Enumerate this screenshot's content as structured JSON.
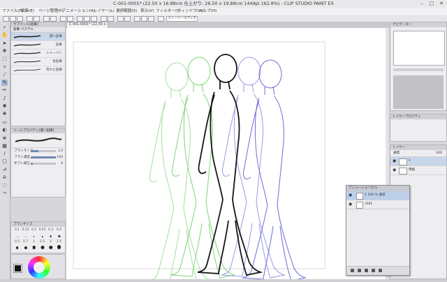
{
  "window": {
    "title": "C-001-0001* (22.50 x 16.88cm 仕上がり: 26.50 x 19.88cm 144dpi 162.8%) - CLIP STUDIO PAINT EX",
    "minimize": "–",
    "maximize": "□",
    "close": "✕"
  },
  "menu": [
    "ファイル(F)",
    "編集(E)",
    "ページ管理(P)",
    "アニメーション(A)",
    "レイヤー(L)",
    "選択範囲(S)",
    "表示(V)",
    "フィルター(I)",
    "ウィンドウ(W)",
    "ヘルプ(H)"
  ],
  "command_bar": {
    "field": "ストーリーエディター"
  },
  "tools": [
    {
      "icon": "zoom-icon",
      "glyph": "⌕"
    },
    {
      "icon": "hand-icon",
      "glyph": "✋"
    },
    {
      "icon": "operation-icon",
      "glyph": "➤"
    },
    {
      "icon": "move-layer-icon",
      "glyph": "✥"
    },
    {
      "icon": "selection-icon",
      "glyph": "⬚"
    },
    {
      "icon": "auto-select-icon",
      "glyph": "✧"
    },
    {
      "icon": "eyedropper-icon",
      "glyph": "⁄"
    },
    {
      "icon": "pen-icon",
      "glyph": "✎"
    },
    {
      "icon": "pencil-icon",
      "glyph": "✏"
    },
    {
      "icon": "brush-icon",
      "glyph": "♪"
    },
    {
      "icon": "airbrush-icon",
      "glyph": "✺"
    },
    {
      "icon": "decoration-icon",
      "glyph": "❋"
    },
    {
      "icon": "eraser-icon",
      "glyph": "▭"
    },
    {
      "icon": "blend-icon",
      "glyph": "◐"
    },
    {
      "icon": "fill-icon",
      "glyph": "⬙"
    },
    {
      "icon": "gradient-icon",
      "glyph": "▦"
    },
    {
      "icon": "figure-icon",
      "glyph": "/"
    },
    {
      "icon": "frame-border-icon",
      "glyph": "▢"
    },
    {
      "icon": "ruler-icon",
      "glyph": "⊿"
    },
    {
      "icon": "text-icon",
      "glyph": "A"
    },
    {
      "icon": "balloon-icon",
      "glyph": "◌"
    },
    {
      "icon": "correct-line-icon",
      "glyph": "⤳"
    }
  ],
  "active_tool": 7,
  "subtool_panel": {
    "header": "サブツール[鉛筆]",
    "tabs": "鉛筆  パステル",
    "brushes": [
      {
        "label": "濃い鉛筆",
        "selected": true
      },
      {
        "label": "鉛筆",
        "selected": false
      },
      {
        "label": "シャーペン",
        "selected": false
      },
      {
        "label": "色鉛筆",
        "selected": false
      },
      {
        "label": "荒れた鉛筆",
        "selected": false
      }
    ]
  },
  "tool_property": {
    "header": "ツールプロパティ[濃い鉛筆]",
    "rows": [
      {
        "label": "ブラシサイズ",
        "value": "3.0",
        "level": 0.3
      },
      {
        "label": "ブラシ濃度",
        "value": "100",
        "level": 1.0
      },
      {
        "label": "手ブレ補正",
        "value": "8",
        "level": 0.08
      }
    ]
  },
  "brush_size": {
    "header": "ブラシサイズ",
    "sizes": [
      "0.1",
      "0.15",
      "0.2",
      "0.25",
      "0.3",
      "0.4",
      "0.5",
      "0.7",
      "1",
      "1.5",
      "2",
      "2.5"
    ]
  },
  "navigator": {
    "header": "ナビゲーター"
  },
  "layer_property": {
    "header": "レイヤープロパティ"
  },
  "layers": {
    "header": "レイヤー",
    "blend_mode": "通常",
    "opacity": "100",
    "items": [
      {
        "name": "1",
        "selected": true
      },
      {
        "name": "用紙",
        "selected": false
      }
    ]
  },
  "animation_cels": {
    "header": "アニメーションセル",
    "items": [
      {
        "name": "1 100 % 通常",
        "selected": true
      },
      {
        "name": "c001",
        "selected": false
      }
    ]
  },
  "colors": {
    "accent": "#6f88b0",
    "onion_prev": "#74d46c",
    "onion_next": "#6b6bd8",
    "ink": "#151515"
  }
}
